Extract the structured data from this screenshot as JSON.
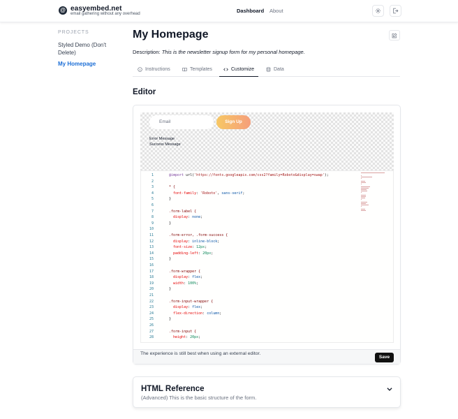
{
  "brand": {
    "name": "easyembed.net",
    "tagline": "email gathering without any overhead",
    "logo_glyph": "@"
  },
  "nav": {
    "dashboard": "Dashboard",
    "about": "About"
  },
  "icons": {
    "settings": "gear-icon",
    "logout": "logout-icon",
    "edit": "pencil-square-icon",
    "chevron": "chevron-down-icon"
  },
  "sidebar": {
    "heading": "PROJECTS",
    "items": [
      {
        "label": "Styled Demo (Don't Delete)",
        "active": false
      },
      {
        "label": "My Homepage",
        "active": true
      }
    ]
  },
  "page": {
    "title": "My Homepage",
    "desc_label": "Description:",
    "desc_text": "This is the newsletter signup form for my personal homepage."
  },
  "tabs": [
    {
      "label": "Instructions",
      "icon": "info-circle-icon",
      "active": false
    },
    {
      "label": "Templates",
      "icon": "book-open-icon",
      "active": false
    },
    {
      "label": "Customize",
      "icon": "code-icon",
      "active": true
    },
    {
      "label": "Data",
      "icon": "database-icon",
      "active": false
    }
  ],
  "editor": {
    "heading": "Editor",
    "preview": {
      "input_placeholder": "Email",
      "button_label": "Sign Up",
      "error": "Error Message",
      "success": "Success Message"
    },
    "status_text": "The experience is still best when using an external editor.",
    "save_label": "Save"
  },
  "code_lines": [
    [
      [
        "@import ",
        "#7a3e9d"
      ],
      [
        "url(",
        "#111"
      ],
      [
        "'https://fonts.googleapis.com/css2?family=Roboto&display=swap'",
        "#a31515"
      ],
      [
        ");",
        "#111"
      ]
    ],
    [],
    [
      [
        "* {",
        "#800000"
      ]
    ],
    [
      [
        "  font-family",
        "#e50000"
      ],
      [
        ": ",
        "#111"
      ],
      [
        "'Roboto'",
        "#a31515"
      ],
      [
        ", ",
        "#111"
      ],
      [
        "sans-serif",
        "#0451a5"
      ],
      [
        ";",
        "#111"
      ]
    ],
    [
      [
        "}",
        "#111"
      ]
    ],
    [],
    [
      [
        ".form-label {",
        "#800000"
      ]
    ],
    [
      [
        "  display",
        "#e50000"
      ],
      [
        ": ",
        "#111"
      ],
      [
        "none",
        "#0451a5"
      ],
      [
        ";",
        "#111"
      ]
    ],
    [
      [
        "}",
        "#111"
      ]
    ],
    [],
    [
      [
        ".form-error, .form-success {",
        "#800000"
      ]
    ],
    [
      [
        "  display",
        "#e50000"
      ],
      [
        ": ",
        "#111"
      ],
      [
        "inline-block",
        "#0451a5"
      ],
      [
        ";",
        "#111"
      ]
    ],
    [
      [
        "  font-size",
        "#e50000"
      ],
      [
        ": ",
        "#111"
      ],
      [
        "12px",
        "#098658"
      ],
      [
        ";",
        "#111"
      ]
    ],
    [
      [
        "  padding-left",
        "#e50000"
      ],
      [
        ": ",
        "#111"
      ],
      [
        "20px",
        "#098658"
      ],
      [
        ";",
        "#111"
      ]
    ],
    [
      [
        "}",
        "#111"
      ]
    ],
    [],
    [
      [
        ".form-wrapper {",
        "#800000"
      ]
    ],
    [
      [
        "  display",
        "#e50000"
      ],
      [
        ": ",
        "#111"
      ],
      [
        "flex",
        "#0451a5"
      ],
      [
        ";",
        "#111"
      ]
    ],
    [
      [
        "  width",
        "#e50000"
      ],
      [
        ": ",
        "#111"
      ],
      [
        "100%",
        "#098658"
      ],
      [
        ";",
        "#111"
      ]
    ],
    [
      [
        "}",
        "#111"
      ]
    ],
    [],
    [
      [
        ".form-input-wrapper {",
        "#800000"
      ]
    ],
    [
      [
        "  display",
        "#e50000"
      ],
      [
        ": ",
        "#111"
      ],
      [
        "flex",
        "#0451a5"
      ],
      [
        ";",
        "#111"
      ]
    ],
    [
      [
        "  flex-direction",
        "#e50000"
      ],
      [
        ": ",
        "#111"
      ],
      [
        "column",
        "#0451a5"
      ],
      [
        ";",
        "#111"
      ]
    ],
    [
      [
        "}",
        "#111"
      ]
    ],
    [],
    [
      [
        ".form-input {",
        "#800000"
      ]
    ],
    [
      [
        "  height",
        "#e50000"
      ],
      [
        ": ",
        "#111"
      ],
      [
        "20px",
        "#098658"
      ],
      [
        ";",
        "#111"
      ]
    ]
  ],
  "reference": {
    "title": "HTML Reference",
    "subtitle": "(Advanced) This is the basic structure of the form."
  }
}
